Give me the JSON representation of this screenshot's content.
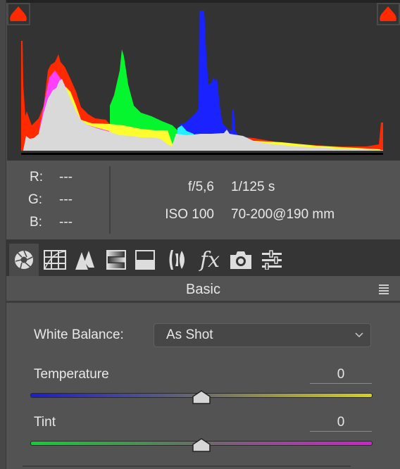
{
  "histogram": {
    "shadow_clipping_warning": "on",
    "highlight_clipping_warning": "on",
    "warning_color": "#ff2a00"
  },
  "readout": {
    "r_label": "R:",
    "r_value": "---",
    "g_label": "G:",
    "g_value": "---",
    "b_label": "B:",
    "b_value": "---",
    "aperture": "f/5,6",
    "shutter": "1/125 s",
    "iso": "ISO 100",
    "lens": "70-200@190 mm"
  },
  "toolbar": {
    "tabs": [
      {
        "name": "basic",
        "icon": "aperture-icon",
        "active": true
      },
      {
        "name": "tone-curve",
        "icon": "tone-curve-icon"
      },
      {
        "name": "detail",
        "icon": "detail-mountains-icon"
      },
      {
        "name": "hsl",
        "icon": "hsl-gradient-icon"
      },
      {
        "name": "split-toning",
        "icon": "split-toning-icon"
      },
      {
        "name": "lens-corrections",
        "icon": "lens-icon"
      },
      {
        "name": "effects",
        "icon": "fx-icon",
        "label": "fx"
      },
      {
        "name": "camera-calibration",
        "icon": "camera-icon"
      },
      {
        "name": "presets",
        "icon": "sliders-icon"
      }
    ]
  },
  "panel": {
    "title": "Basic",
    "menu_icon": "hamburger-menu-icon"
  },
  "white_balance": {
    "label": "White Balance:",
    "value": "As Shot"
  },
  "temperature": {
    "label": "Temperature",
    "value": "0",
    "position": 0.5,
    "gradient": [
      "#1a1ed0",
      "#d8d020"
    ]
  },
  "tint": {
    "label": "Tint",
    "value": "0",
    "position": 0.5,
    "gradient": [
      "#10d030",
      "#d020d0"
    ]
  }
}
